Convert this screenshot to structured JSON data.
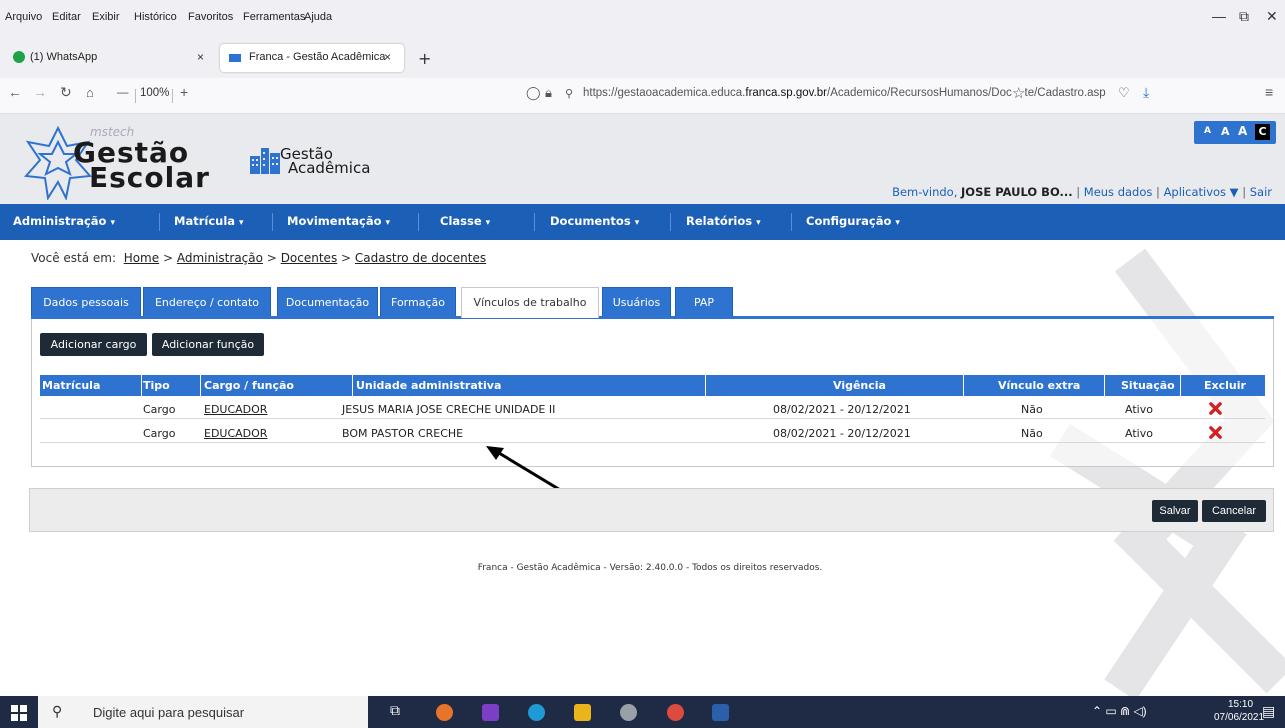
{
  "browser": {
    "menu": [
      "Arquivo",
      "Editar",
      "Exibir",
      "Histórico",
      "Favoritos",
      "Ferramentas",
      "Ajuda"
    ],
    "tabs": [
      {
        "label": "(1) WhatsApp",
        "close": "×"
      },
      {
        "label": "Franca - Gestão Acadêmica",
        "close": "×"
      }
    ],
    "new_tab": "+",
    "zoom": "100%",
    "zoom_minus": "—",
    "zoom_plus": "+",
    "url_prefix": "https://gestaoacademica.educa.",
    "url_domain": "franca.sp.gov.br",
    "url_path": "/Academico/RecursosHumanos/Docente/Cadastro.asp"
  },
  "header": {
    "logo_small": "mstech",
    "logo_line1": "Gestão",
    "logo_line2": "Escolar",
    "app_line1": "Gestão",
    "app_line2": "Acadêmica",
    "font_sizes": [
      "A",
      "A",
      "A",
      "C"
    ],
    "welcome": "Bem-vindo,",
    "user": "JOSE PAULO BO...",
    "sep": "|",
    "my_data": "Meus dados",
    "apps": "Aplicativos ▼",
    "logout": "Sair"
  },
  "nav": [
    "Administração",
    "Matrícula",
    "Movimentação",
    "Classe",
    "Documentos",
    "Relatórios",
    "Configuração"
  ],
  "nav_arrow": "▾",
  "breadcrumb": {
    "prefix": "Você está em:",
    "items": [
      "Home",
      "Administração",
      "Docentes",
      "Cadastro de docentes"
    ],
    "sep": ">"
  },
  "tabs": [
    "Dados pessoais",
    "Endereço / contato",
    "Documentação",
    "Formação",
    "Vínculos de trabalho",
    "Usuários",
    "PAP"
  ],
  "actions": {
    "add_cargo": "Adicionar cargo",
    "add_funcao": "Adicionar função"
  },
  "grid": {
    "headers": [
      "Matrícula",
      "Tipo",
      "Cargo / função",
      "Unidade administrativa",
      "Vigência",
      "Vínculo extra",
      "Situação",
      "Excluir"
    ],
    "rows": [
      {
        "matricula": "",
        "tipo": "Cargo",
        "cargo": "EDUCADOR",
        "unidade": "JESUS MARIA JOSE CRECHE UNIDADE II",
        "vigencia": "08/02/2021 - 20/12/2021",
        "extra": "Não",
        "situacao": "Ativo"
      },
      {
        "matricula": "",
        "tipo": "Cargo",
        "cargo": "EDUCADOR",
        "unidade": "BOM PASTOR CRECHE",
        "vigencia": "08/02/2021 - 20/12/2021",
        "extra": "Não",
        "situacao": "Ativo"
      }
    ]
  },
  "footer": {
    "save": "Salvar",
    "cancel": "Cancelar",
    "copyright": "Franca - Gestão Acadêmica - Versão: 2.40.0.0 - Todos os direitos reservados."
  },
  "taskbar": {
    "search_placeholder": "Digite aqui para pesquisar",
    "time": "15:10",
    "date": "07/06/2021"
  },
  "colors": {
    "nav_blue": "#1c5fb7",
    "tab_blue": "#2f73d0",
    "dark_button": "#1e2a36",
    "delete_red": "#d32020"
  }
}
